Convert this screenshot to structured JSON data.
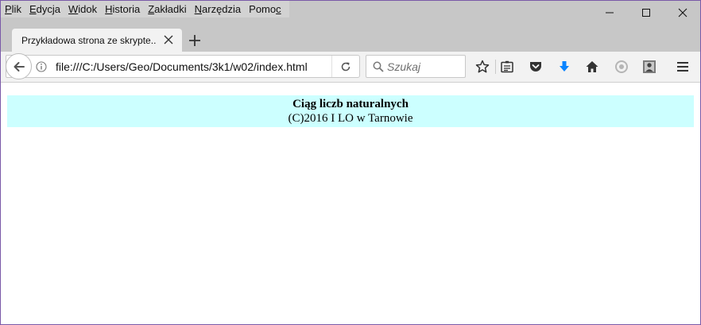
{
  "menu": {
    "items": [
      {
        "accel": "P",
        "rest": "lik"
      },
      {
        "accel": "E",
        "rest": "dycja"
      },
      {
        "accel": "W",
        "rest": "idok"
      },
      {
        "accel": "H",
        "rest": "istoria"
      },
      {
        "accel": "Z",
        "rest": "akładki"
      },
      {
        "accel": "N",
        "rest": "arzędzia"
      },
      {
        "pre": "Pomo",
        "accel": "c",
        "rest": ""
      }
    ]
  },
  "tab": {
    "title": "Przykładowa strona ze skrypte..."
  },
  "urlbar": {
    "url": "file:///C:/Users/Geo/Documents/3k1/w02/index.html"
  },
  "search": {
    "placeholder": "Szukaj"
  },
  "icons": {
    "back": "back-arrow-icon",
    "info": "info-icon",
    "reload": "reload-icon",
    "search": "search-icon",
    "bookmark": "star-icon",
    "reader": "reading-list-icon",
    "pocket": "pocket-icon",
    "downloads": "download-arrow-icon",
    "home": "home-icon",
    "sync": "sync-icon",
    "profile": "profile-icon",
    "menu": "hamburger-menu-icon"
  },
  "colors": {
    "banner_bg": "#ccffff",
    "download_accent": "#0a84ff"
  },
  "page": {
    "heading": "Ciąg liczb naturalnych",
    "footer": "(C)2016 I LO w Tarnowie"
  }
}
